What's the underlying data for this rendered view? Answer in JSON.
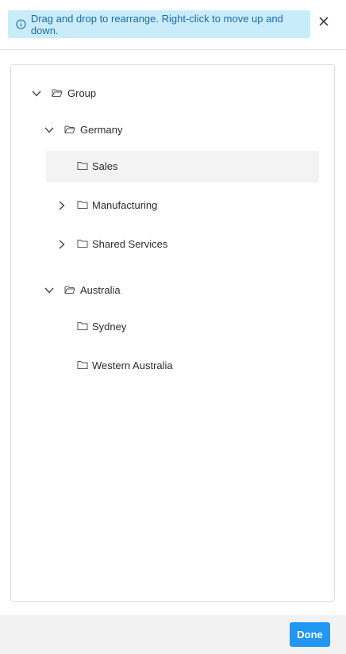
{
  "banner": {
    "icon": "info-circle-icon",
    "text": "Drag and drop to rearrange. Right-click to move up and down."
  },
  "close": {
    "icon": "close-icon"
  },
  "tree": {
    "group": {
      "label": "Group",
      "expanded": true,
      "icon": "folder-open-icon"
    },
    "germany": {
      "label": "Germany",
      "expanded": true,
      "icon": "folder-open-icon"
    },
    "sales": {
      "label": "Sales",
      "selected": true,
      "icon": "folder-icon"
    },
    "manufacturing": {
      "label": "Manufacturing",
      "expanded": false,
      "icon": "folder-icon"
    },
    "shared_services": {
      "label": "Shared Services",
      "expanded": false,
      "icon": "folder-icon"
    },
    "australia": {
      "label": "Australia",
      "expanded": true,
      "icon": "folder-open-icon"
    },
    "sydney": {
      "label": "Sydney",
      "icon": "folder-icon"
    },
    "western_australia": {
      "label": "Western Australia",
      "icon": "folder-icon"
    }
  },
  "footer": {
    "done_label": "Done"
  },
  "colors": {
    "banner_bg": "#c9ecfa",
    "banner_text": "#1e6aa8",
    "primary": "#2196f3",
    "selected_bg": "#f3f3f3"
  }
}
